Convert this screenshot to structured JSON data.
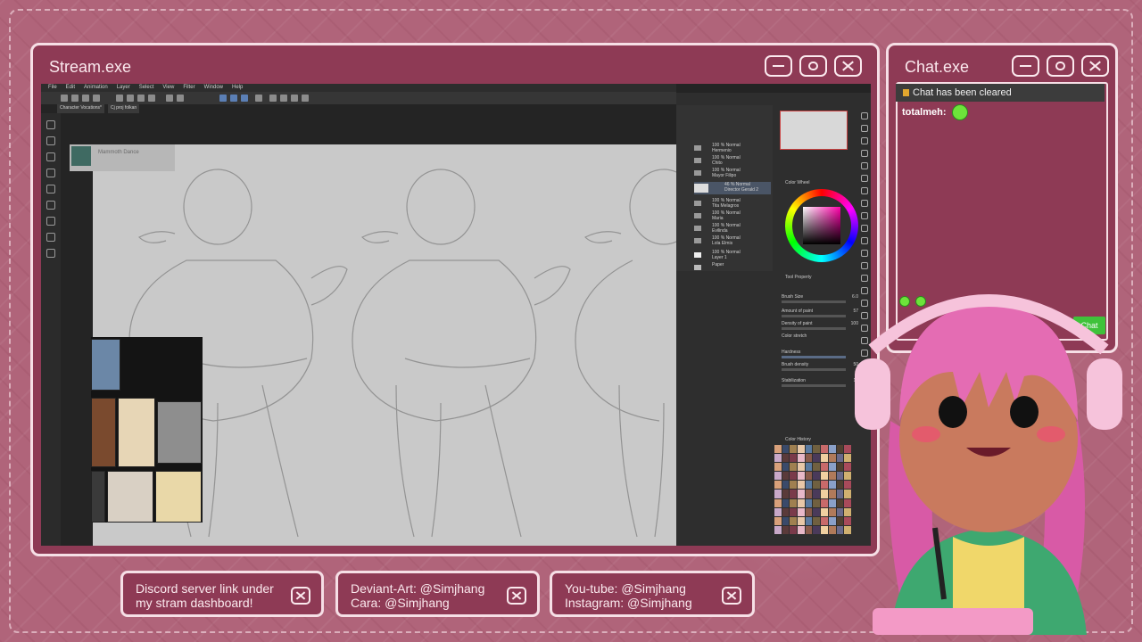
{
  "stream_window": {
    "title": "Stream.exe",
    "app_menu": [
      "File",
      "Edit",
      "Animation",
      "Layer",
      "Select",
      "View",
      "Filter",
      "Window",
      "Help"
    ],
    "tabs": [
      "Character Vocations*",
      "Cj proj folkan"
    ],
    "file_chip": "Mammoth Dance",
    "layers": [
      {
        "pct": "100 % Normal",
        "name": "Hermenio"
      },
      {
        "pct": "100 % Normal",
        "name": "Chito"
      },
      {
        "pct": "100 % Normal",
        "name": "Mayor Filipo"
      },
      {
        "pct": "46 % Normal",
        "name": "Director Gerald 2"
      },
      {
        "pct": "100 % Normal",
        "name": "Tita Melagros"
      },
      {
        "pct": "100 % Normal",
        "name": "Maria"
      },
      {
        "pct": "100 % Normal",
        "name": "Evilinda"
      },
      {
        "pct": "100 % Normal",
        "name": "Lola Elmis"
      },
      {
        "pct": "100 % Normal",
        "name": "Layer 1"
      },
      {
        "pct": "",
        "name": "Paper"
      }
    ],
    "color_wheel_label": "Color Wheel",
    "tool_property_label": "Tool Property",
    "tool_property": [
      {
        "label": "Brush Size",
        "value": "6.0"
      },
      {
        "label": "Amount of paint",
        "value": "57"
      },
      {
        "label": "Density of paint",
        "value": "100"
      },
      {
        "label": "Color stretch",
        "value": ""
      },
      {
        "label": "Hardness",
        "value": ""
      },
      {
        "label": "Brush density",
        "value": "50"
      },
      {
        "label": "Stabilization",
        "value": "10"
      }
    ],
    "color_history_label": "Color History"
  },
  "chat_window": {
    "title": "Chat.exe",
    "cleared_text": "Chat has been cleared",
    "user": "totalmeh:",
    "chat_button": "Chat"
  },
  "info_boxes": [
    {
      "text": "Discord server link under\nmy stram dashboard!"
    },
    {
      "text": "Deviant-Art: @Simjhang\nCara: @Simjhang"
    },
    {
      "text": "You-tube: @Simjhang\nInstagram: @Simjhang"
    }
  ],
  "colors": {
    "background": "#b0647a",
    "window": "#8e3a55",
    "border": "#f6dfe6",
    "chat_green": "#3fc23a"
  }
}
